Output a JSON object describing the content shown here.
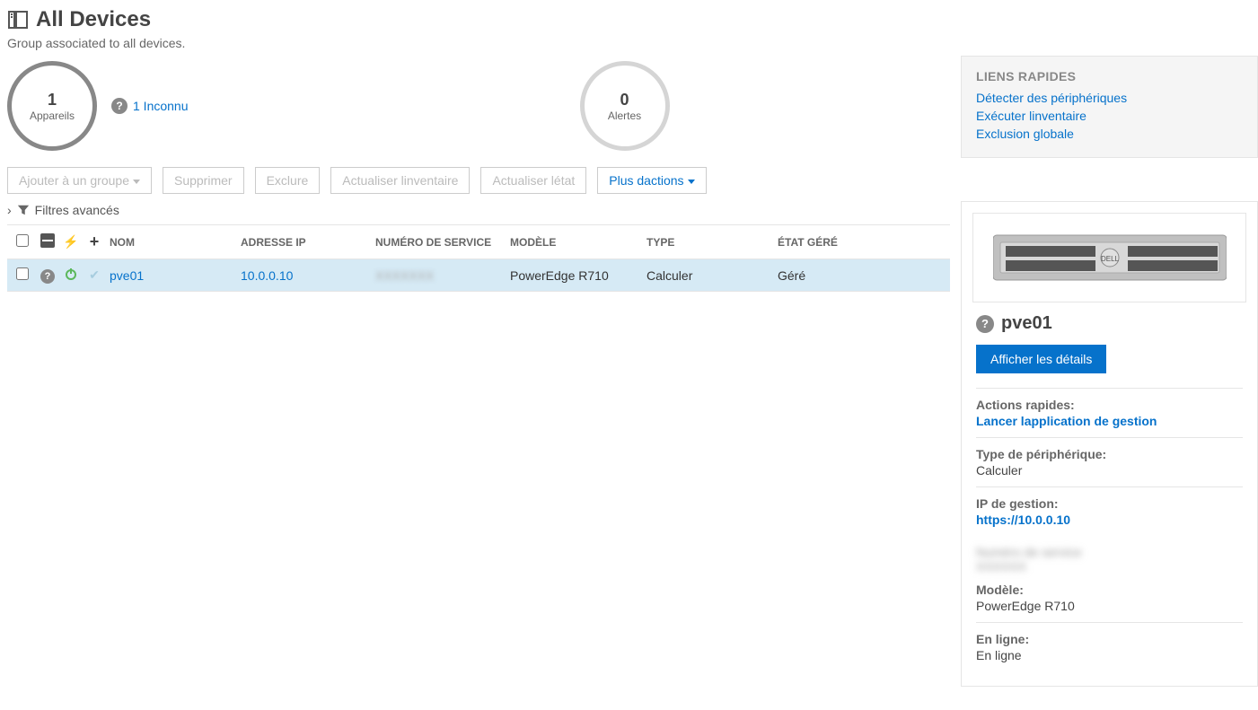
{
  "header": {
    "title": "All Devices",
    "subtitle": "Group associated to all devices."
  },
  "stats": {
    "devices_count": "1",
    "devices_label": "Appareils",
    "unknown_link": "1 Inconnu",
    "alerts_count": "0",
    "alerts_label": "Alertes"
  },
  "actions": {
    "add_group": "Ajouter à un groupe",
    "delete": "Supprimer",
    "exclude": "Exclure",
    "refresh_inventory": "Actualiser linventaire",
    "refresh_state": "Actualiser létat",
    "more_actions": "Plus dactions"
  },
  "filters": {
    "advanced": "Filtres avancés"
  },
  "table": {
    "headers": {
      "nom": "NOM",
      "ip": "ADRESSE IP",
      "service": "NUMÉRO DE SERVICE",
      "model": "MODÈLE",
      "type": "TYPE",
      "etat": "ÉTAT GÉRÉ"
    },
    "rows": [
      {
        "nom": "pve01",
        "ip": "10.0.0.10",
        "service": "XXXXXXX",
        "model": "PowerEdge R710",
        "type": "Calculer",
        "etat": "Géré"
      }
    ]
  },
  "sidebar": {
    "quick_links": {
      "title": "LIENS RAPIDES",
      "detect": "Détecter des périphériques",
      "inventory": "Exécuter linventaire",
      "exclusion": "Exclusion globale"
    },
    "detail": {
      "name": "pve01",
      "show_details": "Afficher les détails",
      "quick_actions_label": "Actions rapides:",
      "launch_mgmt": "Lancer lapplication de gestion",
      "device_type_label": "Type de périphérique:",
      "device_type_value": "Calculer",
      "mgmt_ip_label": "IP de gestion:",
      "mgmt_ip_value": "https://10.0.0.10",
      "blurred1": "Numéro de service",
      "blurred2": "XXXXXX",
      "model_label": "Modèle:",
      "model_value": "PowerEdge R710",
      "online_label": "En ligne:",
      "online_value": "En ligne"
    }
  }
}
